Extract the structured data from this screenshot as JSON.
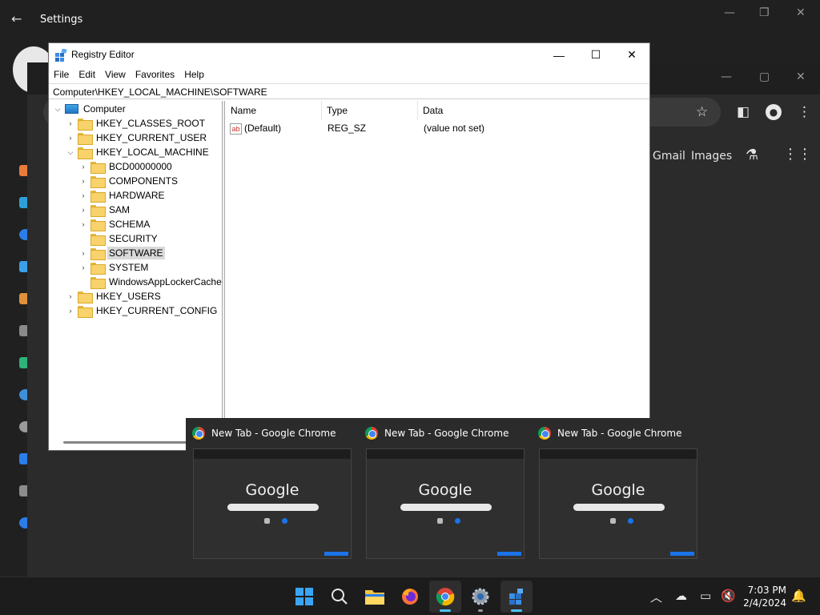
{
  "settings": {
    "title": "Settings"
  },
  "regedit": {
    "title": "Registry Editor",
    "menu": [
      "File",
      "Edit",
      "View",
      "Favorites",
      "Help"
    ],
    "address": "Computer\\HKEY_LOCAL_MACHINE\\SOFTWARE",
    "tree": {
      "root": "Computer",
      "hkcr": "HKEY_CLASSES_ROOT",
      "hkcu": "HKEY_CURRENT_USER",
      "hklm": "HKEY_LOCAL_MACHINE",
      "hklm_children": [
        "BCD00000000",
        "COMPONENTS",
        "HARDWARE",
        "SAM",
        "SCHEMA",
        "SECURITY",
        "SOFTWARE",
        "SYSTEM",
        "WindowsAppLockerCache"
      ],
      "hku": "HKEY_USERS",
      "hkcc": "HKEY_CURRENT_CONFIG"
    },
    "columns": {
      "name": "Name",
      "type": "Type",
      "data": "Data"
    },
    "values": [
      {
        "icon": "ab",
        "name": "(Default)",
        "type": "REG_SZ",
        "data": "(value not set)"
      }
    ]
  },
  "chrome": {
    "links": {
      "gmail": "Gmail",
      "images": "Images"
    }
  },
  "thumbnails": [
    {
      "title": "New Tab - Google Chrome",
      "logo": "Google"
    },
    {
      "title": "New Tab - Google Chrome",
      "logo": "Google"
    },
    {
      "title": "New Tab - Google Chrome",
      "logo": "Google"
    }
  ],
  "clock": {
    "time": "7:03 PM",
    "date": "2/4/2024"
  }
}
